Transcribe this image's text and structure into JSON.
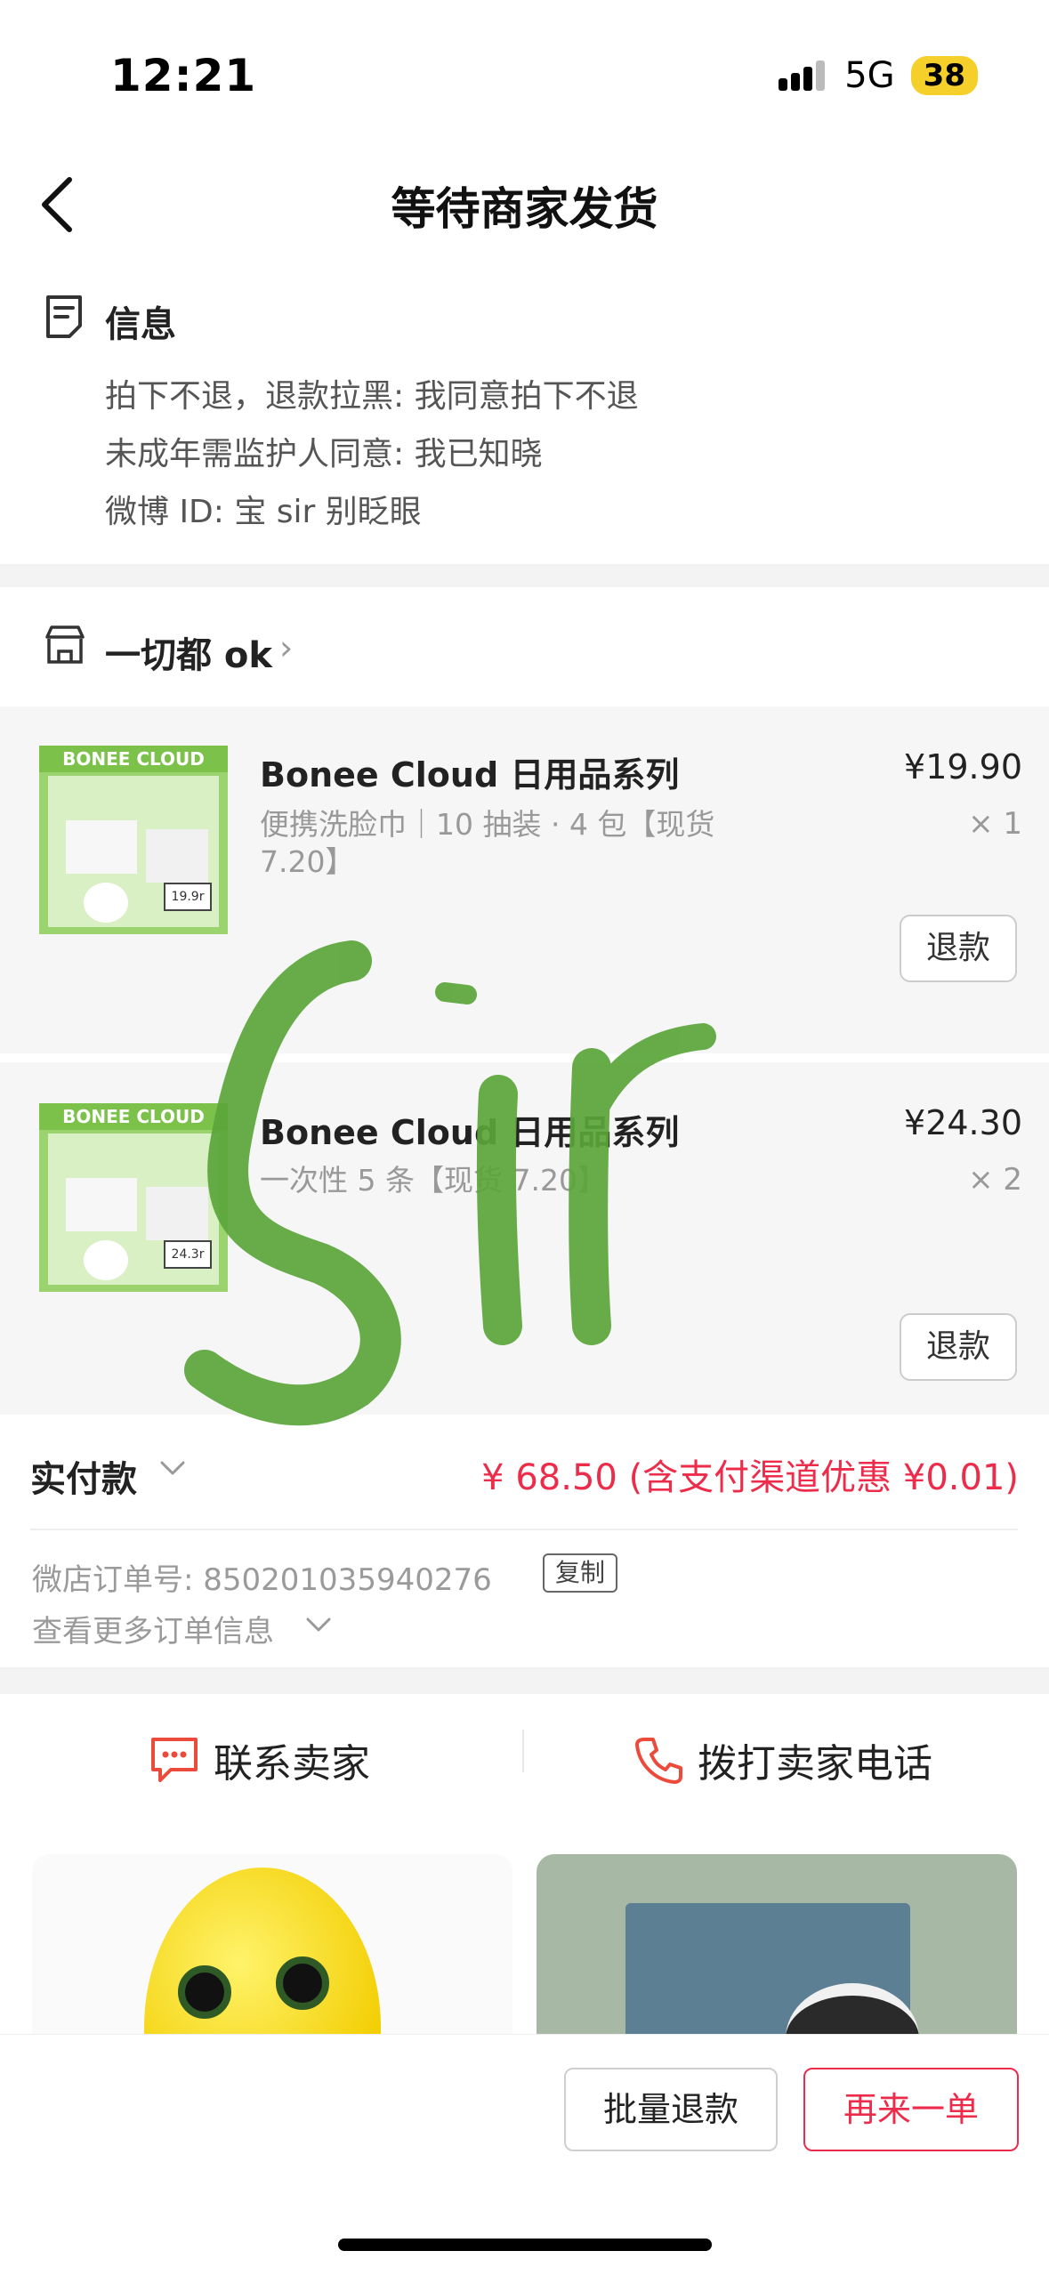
{
  "status": {
    "time": "12:21",
    "network": "5G",
    "battery": "38"
  },
  "nav": {
    "title": "等待商家发货"
  },
  "info": {
    "title": "信息",
    "lines": [
      "拍下不退，退款拉黑: 我同意拍下不退",
      "未成年需监护人同意: 我已知晓",
      "微博 ID: 宝 sir 别眨眼"
    ]
  },
  "shop": {
    "name": "一切都 ok"
  },
  "products": [
    {
      "title": "Bonee Cloud 日用品系列",
      "price": "¥19.90",
      "spec": "便携洗脸巾｜10 抽装 · 4 包【现货 7.20】",
      "qty": "× 1",
      "refund": "退款",
      "thumb_band": "BONEE CLOUD",
      "thumb_price": "19.9r"
    },
    {
      "title": "Bonee Cloud 日用品系列",
      "price": "¥24.30",
      "spec": "一次性     5 条【现货 7.20】",
      "qty": "× 2",
      "refund": "退款",
      "thumb_band": "BONEE CLOUD",
      "thumb_price": "24.3r"
    }
  ],
  "payment": {
    "label": "实付款",
    "amount": "¥ 68.50 (含支付渠道优惠 ¥0.01)"
  },
  "order": {
    "number_text": "微店订单号:  850201035940276",
    "copy": "复制",
    "more": "查看更多订单信息"
  },
  "contact": {
    "seller": "联系卖家",
    "phone": "拨打卖家电话"
  },
  "bottom": {
    "bulk_refund": "批量退款",
    "reorder": "再来一单"
  },
  "colors": {
    "accent_red": "#ec2c4a",
    "overlay_green": "#5aa53a"
  },
  "overlay_text": "Sir"
}
